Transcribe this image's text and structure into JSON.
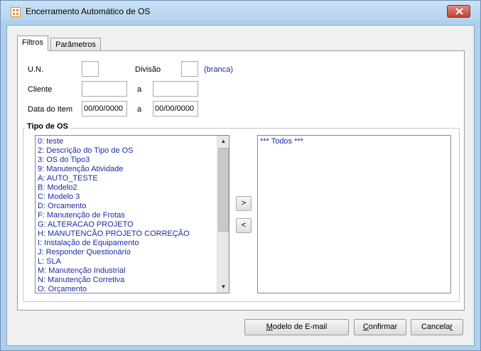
{
  "window": {
    "title": "Encerramento Automático de OS",
    "close_icon": "close-icon",
    "app_icon": "app-icon"
  },
  "tabs": [
    {
      "label": "Filtros",
      "active": true
    },
    {
      "label": "Parâmetros",
      "active": false
    }
  ],
  "form": {
    "un_label": "U.N.",
    "un_value": "",
    "divisao_label": "Divisão",
    "divisao_value": "",
    "divisao_hint": "(branca)",
    "cliente_label": "Cliente",
    "cliente_from": "",
    "cliente_to_label": "a",
    "cliente_to": "",
    "data_label": "Data do Item",
    "data_from": "00/00/0000",
    "data_to_label": "a",
    "data_to": "00/00/0000"
  },
  "tipo_os": {
    "title": "Tipo de OS",
    "available": [
      "0: teste",
      "2: Descrição do Tipo de OS",
      "3: OS do Tipo3",
      "9: Manutenção Atividade",
      "A: AUTO_TESTE",
      "B: Modelo2",
      "C: Modelo 3",
      "D: Orcamento",
      "F: Manutenção de Frotas",
      "G: ALTERACAO PROJETO",
      "H: MANUTENCÃO PROJETO  CORREÇÃO",
      "I: Instalação de Equipamento",
      "J: Responder Questionário",
      "L: SLA",
      "M: Manutenção Industrial",
      "N: Manutenção Corretiva",
      "O: Orçamento"
    ],
    "selected": [
      "*** Todos ***"
    ],
    "add_label": ">",
    "remove_label": "<"
  },
  "buttons": {
    "email_mnemonic": "M",
    "email_rest": "odelo de E-mail",
    "confirm_mnemonic": "C",
    "confirm_rest": "onfirmar",
    "cancel_prefix": "Cancela",
    "cancel_mnemonic": "r"
  },
  "colors": {
    "list_text": "#1a2ca3",
    "title_bar": "#b6d3ee",
    "close_button": "#c4432e"
  }
}
